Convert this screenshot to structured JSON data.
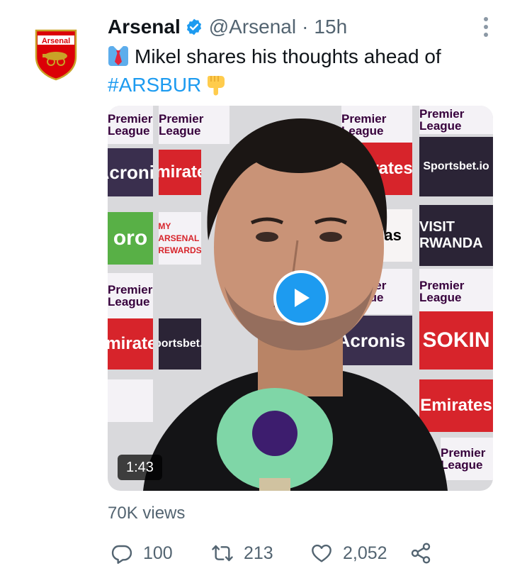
{
  "tweet": {
    "author_name": "Arsenal",
    "handle": "@Arsenal",
    "separator": "·",
    "time": "15h",
    "text_main": "Mikel shares his thoughts ahead of",
    "hashtag": "#ARSBUR",
    "video_duration": "1:43",
    "views": "70K views",
    "replies": "100",
    "retweets": "213",
    "likes": "2,052"
  },
  "avatar": {
    "badge_text": "Arsenal"
  },
  "video_backdrop": {
    "premier_league": "Premier League",
    "emirates": "Emirates",
    "acronis": "Acronis",
    "sportsbet": "Sportsbet.io",
    "visit_rwanda": "VISIT RWANDA",
    "adidas": "adidas",
    "my_arsenal_rewards": "MY ARSENAL REWARDS",
    "sokin": "SOKIN",
    "oro": "oro"
  },
  "colors": {
    "accent": "#1d9bf0",
    "secondary_text": "#536471",
    "arsenal_red": "#db0007"
  },
  "icons": [
    "verified-badge-icon",
    "more-icon",
    "necktie-emoji",
    "pointing-down-emoji",
    "play-icon",
    "reply-icon",
    "retweet-icon",
    "like-icon",
    "share-icon"
  ]
}
